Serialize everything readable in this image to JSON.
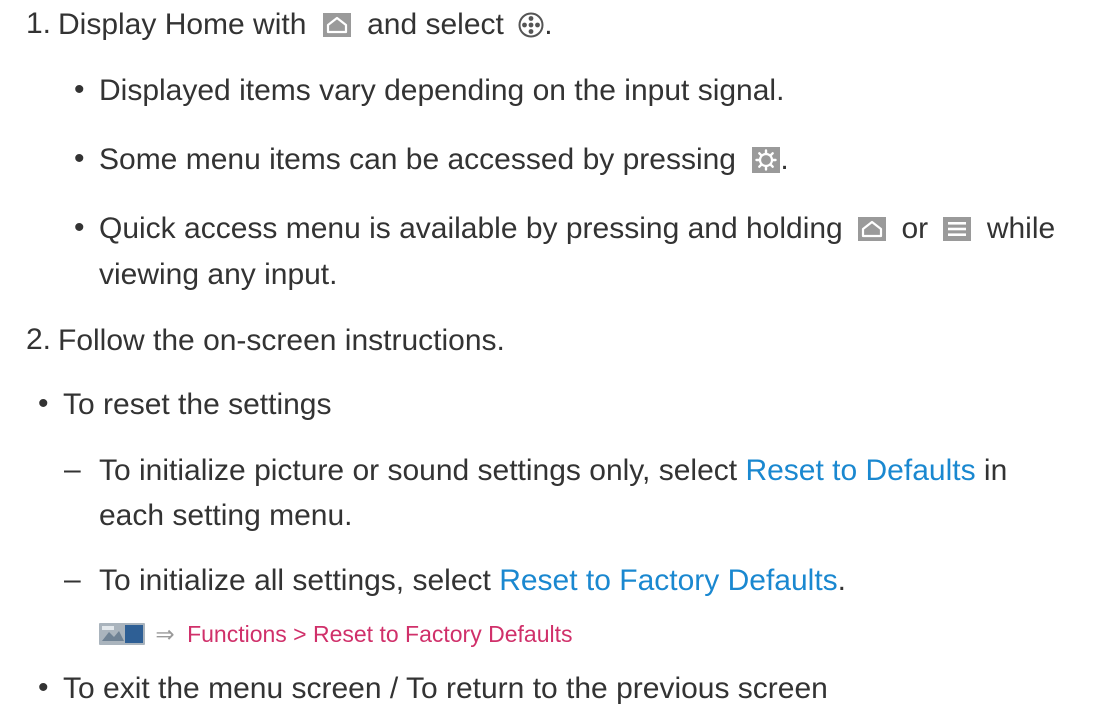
{
  "steps": [
    {
      "number": "1.",
      "text_before_home": "Display Home with",
      "text_between": "and select",
      "text_after": "."
    },
    {
      "number": "2.",
      "text": "Follow the on-screen instructions."
    }
  ],
  "step1_bullets": [
    {
      "text": "Displayed items vary depending on the input signal."
    },
    {
      "text_before": "Some menu items can be accessed by pressing",
      "text_after": "."
    },
    {
      "text_before": "Quick access menu is available by pressing and holding",
      "text_or": "or",
      "text_after": "while",
      "text_cont": "viewing any input."
    }
  ],
  "reset": {
    "bullet": "To reset the settings",
    "dash1_before": "To initialize picture or sound settings only, select",
    "dash1_link": "Reset to Defaults",
    "dash1_after": "in",
    "dash1_cont": "each setting menu.",
    "dash2_before": "To initialize all settings, select",
    "dash2_link": "Reset to Factory Defaults",
    "dash2_after": ".",
    "path_arrow": "⇒",
    "path_text": "Functions > Reset to Factory Defaults"
  },
  "exit": {
    "bullet": "To exit the menu screen / To return to the previous screen"
  },
  "markers": {
    "bullet": "•",
    "dash": "–"
  },
  "colors": {
    "link": "#1a88d0",
    "path": "#d0306a",
    "icon_gray": "#9a9a9a",
    "text": "#333333"
  },
  "icons": [
    "home-icon",
    "apps-icon",
    "settings-icon",
    "menu-icon",
    "tv-screen-icon",
    "return-icon"
  ]
}
